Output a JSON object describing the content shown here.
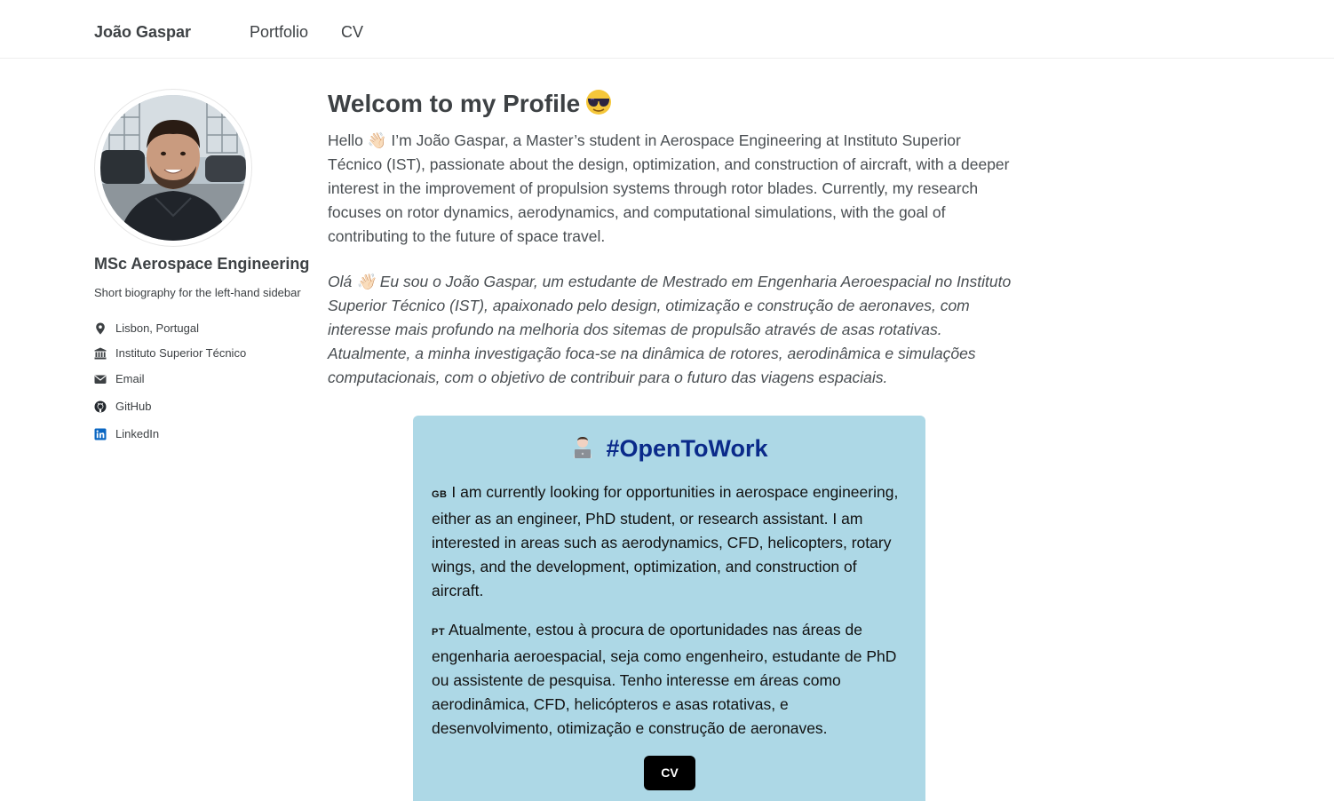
{
  "masthead": {
    "site_title": "João Gaspar",
    "nav": [
      {
        "label": "Portfolio"
      },
      {
        "label": "CV"
      }
    ]
  },
  "sidebar": {
    "name": "MSc Aerospace Engineering",
    "bio": "Short biography for the left-hand sidebar",
    "links": [
      {
        "label": "Lisbon, Portugal",
        "icon": "map-marker-icon"
      },
      {
        "label": "Instituto Superior Técnico",
        "icon": "university-icon"
      },
      {
        "label": "Email",
        "icon": "envelope-icon"
      },
      {
        "label": "GitHub",
        "icon": "github-icon"
      },
      {
        "label": "LinkedIn",
        "icon": "linkedin-icon"
      }
    ]
  },
  "main": {
    "title": "Welcom to my Profile",
    "intro_en": "Hello 👋🏻 I’m João Gaspar, a Master’s student in Aerospace Engineering at Instituto Superior Técnico (IST), passionate about the design, optimization, and construction of aircraft, with a deeper interest in the improvement of propulsion systems through rotor blades. Currently, my research focuses on rotor dynamics, aerodynamics, and computational simulations, with the goal of contributing to the future of space travel.",
    "intro_pt": "Olá 👋🏻 Eu sou o João Gaspar, um estudante de Mestrado em Engenharia Aeroespacial no Instituto Superior Técnico (IST), apaixonado pelo design, otimização e construção de aeronaves, com interesse mais profundo na melhoria dos sitemas de propulsão através de asas rotativas. Atualmente, a minha investigação foca-se na dinâmica de rotores, aerodinâmica e simulações computacionais, com o objetivo de contribuir para o futuro das viagens espaciais."
  },
  "open_to_work": {
    "title": "#OpenToWork",
    "en_flag": "GB",
    "en_text": "I am currently looking for opportunities in aerospace engineering, either as an engineer, PhD student, or research assistant. I am interested in areas such as aerodynamics, CFD, helicopters, rotary wings, and the development, optimization, and construction of aircraft.",
    "pt_flag": "PT",
    "pt_text": "Atualmente, estou à procura de oportunidades nas áreas de engenharia aeroespacial, seja como engenheiro, estudante de PhD ou assistente de pesquisa. Tenho interesse em áreas como aerodinâmica, CFD, helicópteros e asas rotativas, e desenvolvimento, otimização e construção de aeronaves.",
    "button_label": "CV"
  },
  "colors": {
    "box_background": "#add8e6",
    "box_title": "#0a2a8a",
    "button_background": "#000000",
    "linkedin": "#0a66c2"
  }
}
